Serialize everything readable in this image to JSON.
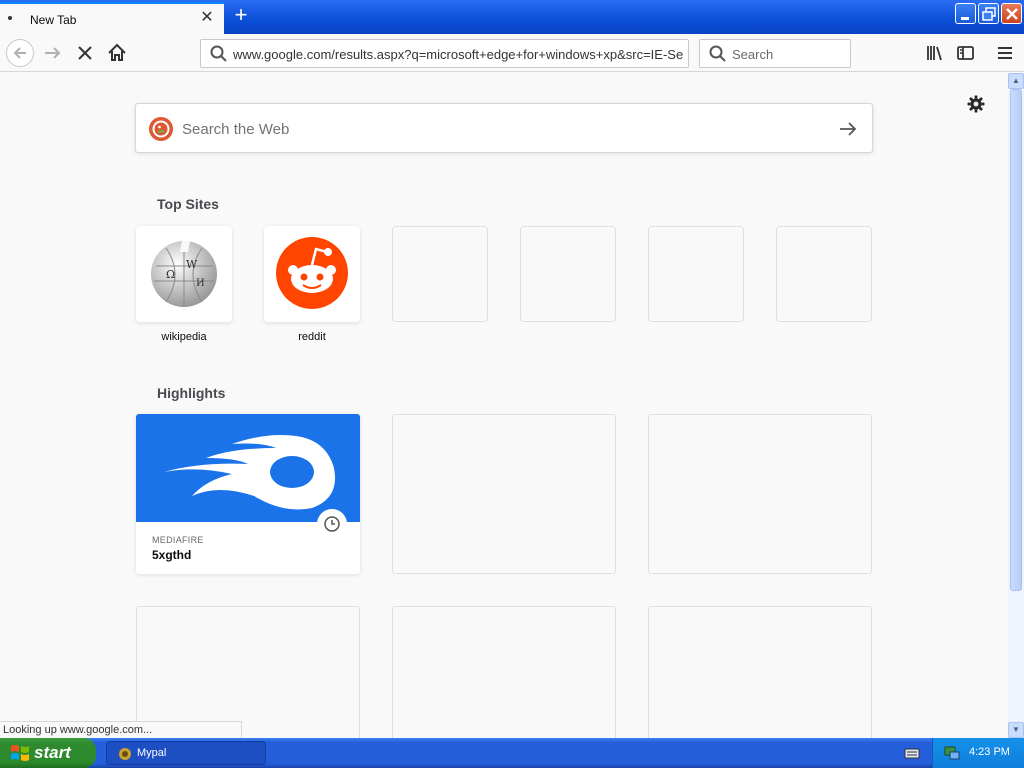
{
  "window": {
    "tab_title": "New Tab",
    "new_tab_symbol": "+",
    "close_tab_symbol": "✕"
  },
  "navbar": {
    "url": "www.google.com/results.aspx?q=microsoft+edge+for+windows+xp&src=IE-Se",
    "search_placeholder": "Search"
  },
  "newtab": {
    "search_placeholder": "Search the Web",
    "top_sites_title": "Top Sites",
    "top_sites": [
      {
        "label": "wikipedia",
        "icon": "wikipedia-icon"
      },
      {
        "label": "reddit",
        "icon": "reddit-icon"
      },
      {
        "label": ""
      },
      {
        "label": ""
      },
      {
        "label": ""
      },
      {
        "label": ""
      }
    ],
    "highlights_title": "Highlights",
    "highlights": [
      {
        "host": "MEDIAFIRE",
        "title": "5xgthd",
        "icon": "mediafire-icon"
      }
    ]
  },
  "status_text": "Looking up www.google.com...",
  "taskbar": {
    "start_label": "start",
    "task_label": "Mypal",
    "clock": "4:23 PM"
  },
  "colors": {
    "accent": "#0a84ff",
    "taskbar": "#245edb",
    "start": "#2f8a2f",
    "mediafire": "#1a73e8",
    "reddit": "#ff4500"
  }
}
